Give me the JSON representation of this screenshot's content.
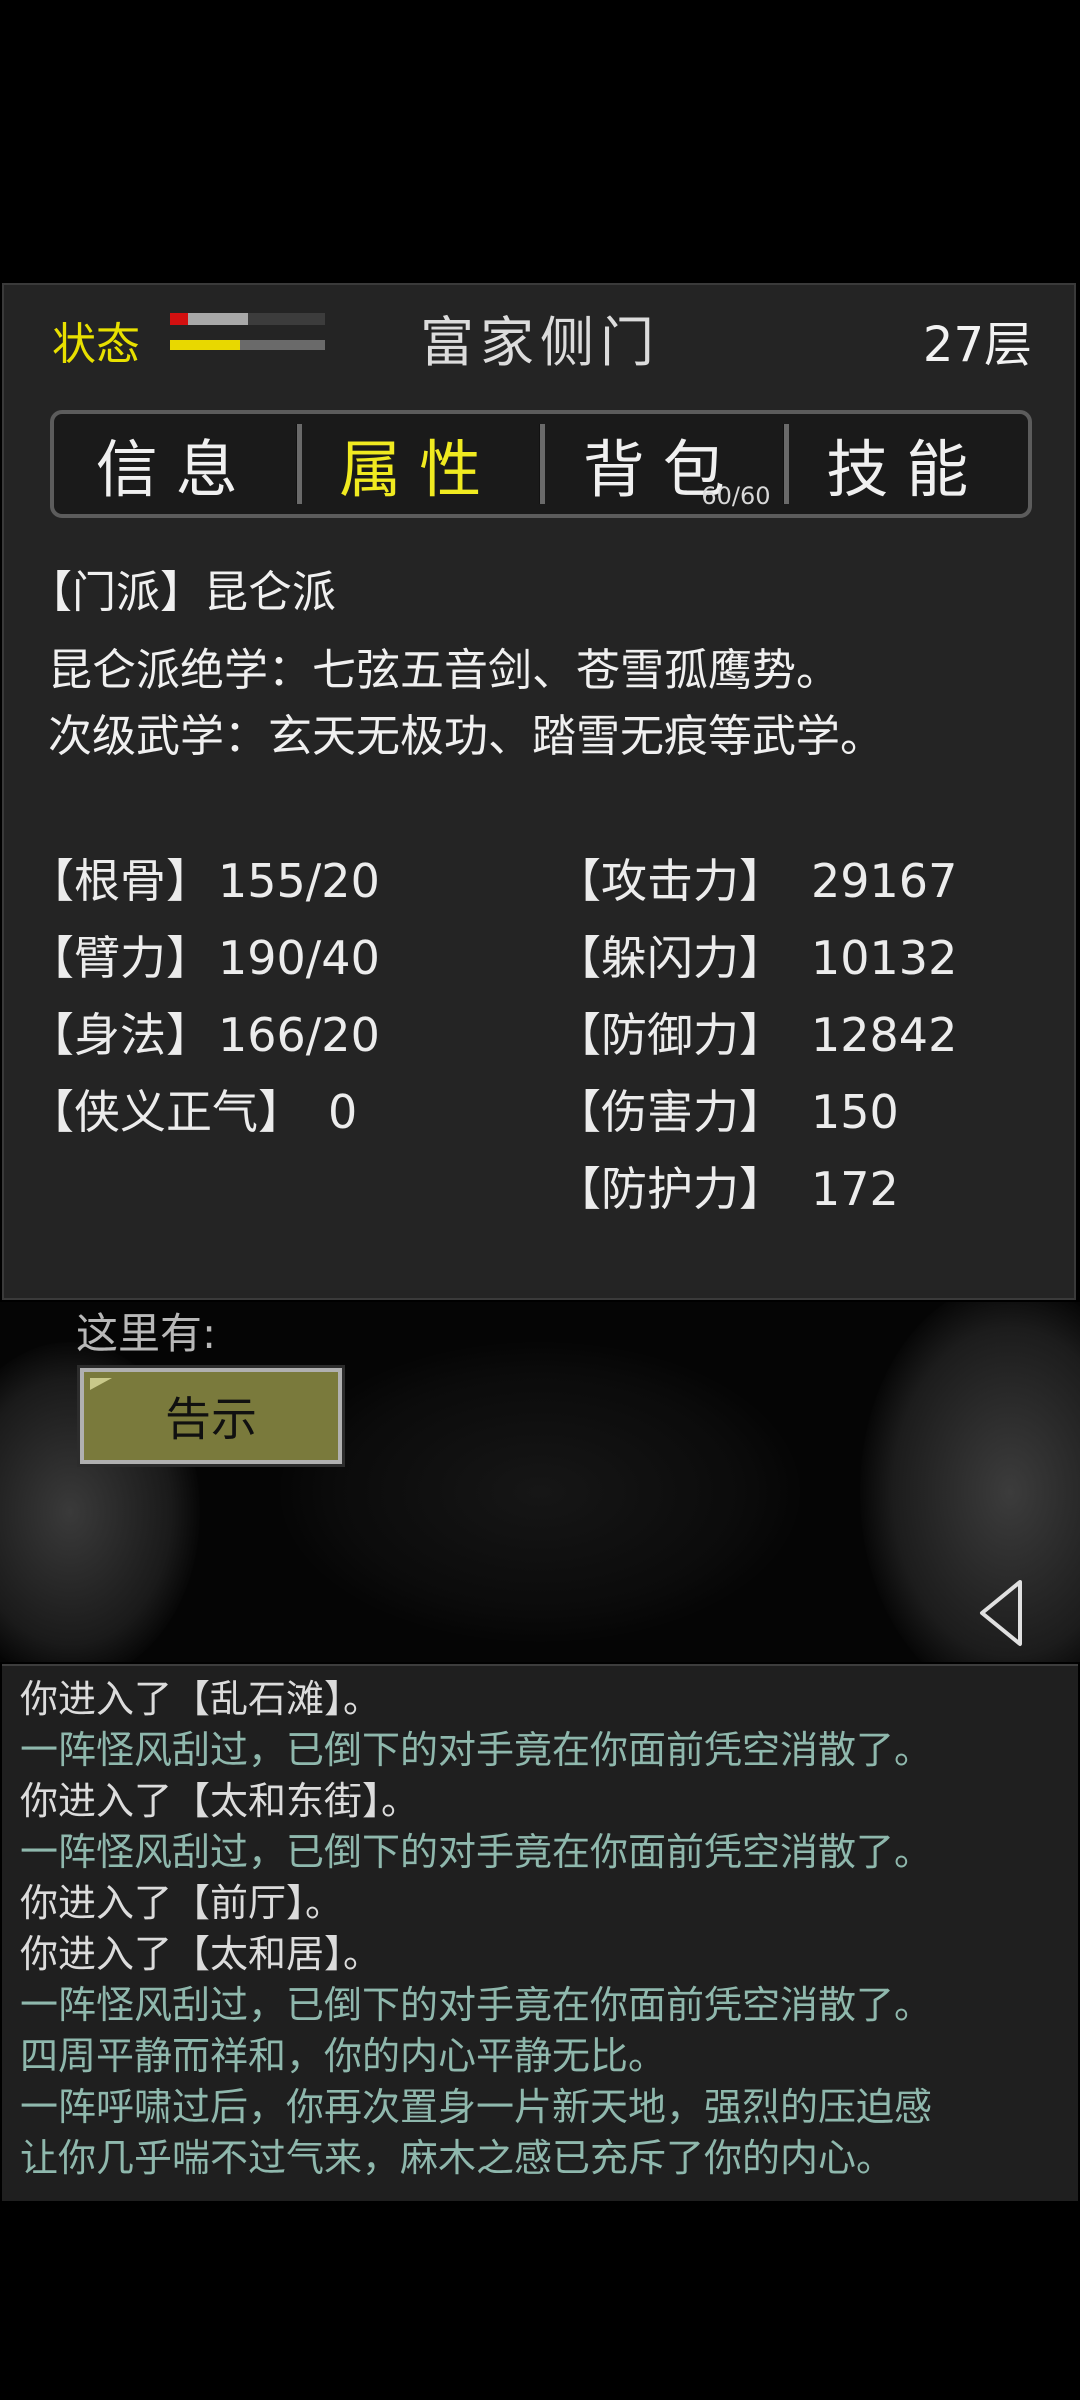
{
  "header": {
    "status_label": "状态",
    "hp_fraction": 0.5,
    "mp_fraction": 0.45,
    "location": "富家侧门",
    "floor": "27层"
  },
  "tabs": [
    {
      "label": "信息",
      "active": false
    },
    {
      "label": "属性",
      "active": true
    },
    {
      "label": "背包",
      "active": false,
      "badge": "60/60"
    },
    {
      "label": "技能",
      "active": false
    }
  ],
  "sect": {
    "label": "【门派】昆仑派",
    "line1": "昆仑派绝学：七弦五音剑、苍雪孤鹰势。",
    "line2": "次级武学：玄天无极功、踏雪无痕等武学。"
  },
  "stats_left": [
    {
      "key": "【根骨】",
      "value": "155/20"
    },
    {
      "key": "【臂力】",
      "value": "190/40"
    },
    {
      "key": "【身法】",
      "value": "166/20"
    },
    {
      "key": "【侠义正气】",
      "value": "0"
    }
  ],
  "stats_right": [
    {
      "key": "【攻击力】",
      "value": "29167"
    },
    {
      "key": "【躲闪力】",
      "value": "10132"
    },
    {
      "key": "【防御力】",
      "value": "12842"
    },
    {
      "key": "【伤害力】",
      "value": "150"
    },
    {
      "key": "【防护力】",
      "value": "172"
    }
  ],
  "scene": {
    "here_label": "这里有:",
    "notice_button": "告示"
  },
  "log": [
    {
      "text": "你进入了【乱石滩】。",
      "color": "#dcdcdc"
    },
    {
      "text": "一阵怪风刮过，已倒下的对手竟在你面前凭空消散了。",
      "color": "#8fb8ad"
    },
    {
      "text": "你进入了【太和东街】。",
      "color": "#dcdcdc"
    },
    {
      "text": "一阵怪风刮过，已倒下的对手竟在你面前凭空消散了。",
      "color": "#8fb8ad"
    },
    {
      "text": "你进入了【前厅】。",
      "color": "#dcdcdc"
    },
    {
      "text": "你进入了【太和居】。",
      "color": "#dcdcdc"
    },
    {
      "text": "一阵怪风刮过，已倒下的对手竟在你面前凭空消散了。",
      "color": "#8fb8ad"
    },
    {
      "text": "四周平静而祥和，你的内心平静无比。",
      "color": "#8fb8ad"
    },
    {
      "text": "一阵呼啸过后，你再次置身一片新天地，强烈的压迫感",
      "color": "#8fb8ad"
    },
    {
      "text": "让你几乎喘不过气来，麻木之感已充斥了你的内心。",
      "color": "#8fb8ad"
    }
  ]
}
